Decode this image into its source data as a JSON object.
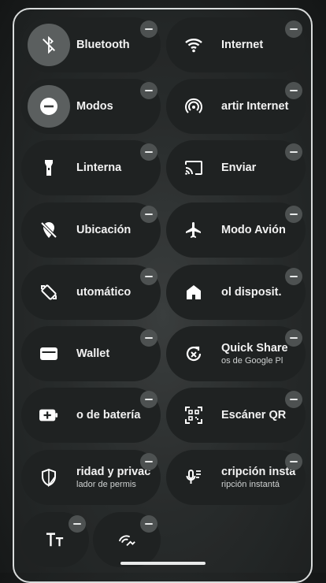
{
  "tiles": [
    {
      "id": "bluetooth",
      "label": "Bluetooth",
      "icon": "bluetooth-off-icon",
      "active": true
    },
    {
      "id": "internet",
      "label": "Internet",
      "icon": "wifi-icon"
    },
    {
      "id": "modos",
      "label": "Modos",
      "icon": "do-not-disturb-icon",
      "active": true
    },
    {
      "id": "hotspot",
      "label": "artir Internet",
      "icon": "hotspot-icon"
    },
    {
      "id": "linterna",
      "label": "Linterna",
      "icon": "flashlight-icon"
    },
    {
      "id": "enviar",
      "label": "Enviar",
      "icon": "cast-icon"
    },
    {
      "id": "ubicacion",
      "label": "Ubicación",
      "icon": "location-off-icon"
    },
    {
      "id": "modo-avion",
      "label": "Modo Avión",
      "icon": "airplane-icon"
    },
    {
      "id": "rotacion",
      "label": "utomático",
      "icon": "auto-rotate-icon"
    },
    {
      "id": "control-dispositivos",
      "label": "ol disposit.",
      "icon": "home-icon"
    },
    {
      "id": "wallet",
      "label": "Wallet",
      "icon": "wallet-icon"
    },
    {
      "id": "quick-share",
      "label": "Quick Share",
      "sub": "os de Google Pl",
      "icon": "quick-share-icon"
    },
    {
      "id": "ahorro-bateria",
      "label": "o de batería",
      "icon": "battery-saver-icon"
    },
    {
      "id": "escaner-qr",
      "label": "Escáner QR",
      "icon": "qr-code-icon"
    },
    {
      "id": "privacidad",
      "label": "ridad y privac",
      "sub": "lador de permis",
      "icon": "shield-icon"
    },
    {
      "id": "transcripcion",
      "label": "cripción insta",
      "sub": "ripción instantá",
      "icon": "mic-text-icon"
    },
    {
      "id": "tamano-fuente",
      "label": "",
      "icon": "font-size-icon",
      "small": true
    },
    {
      "id": "acceso",
      "label": "",
      "icon": "hearing-icon",
      "small": true
    }
  ]
}
